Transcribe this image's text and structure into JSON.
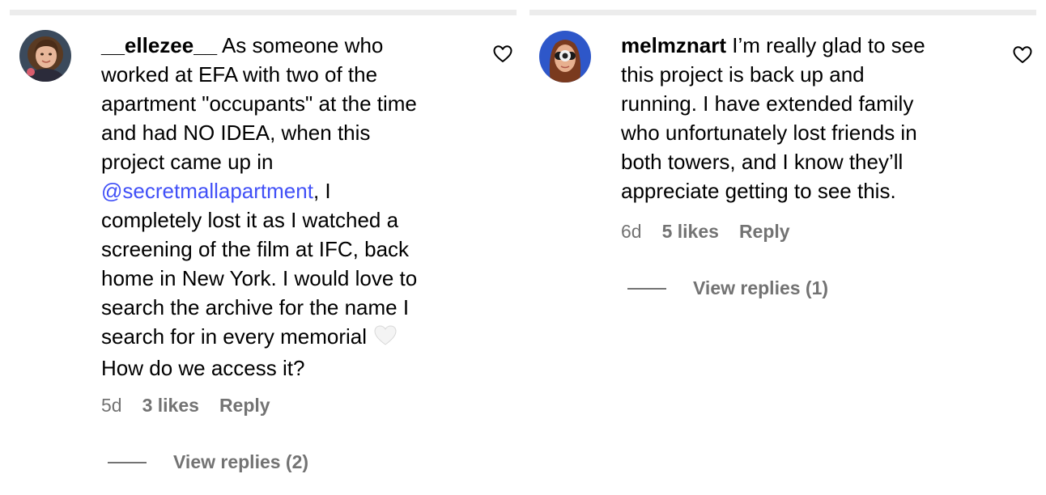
{
  "comments": [
    {
      "username": "__ellezee__",
      "text_before_mention": "As someone who\nworked at EFA with two of the\napartment \"occupants\" at the time\nand had NO IDEA, when this\nproject came up in\n",
      "mention": "@secretmallapartment",
      "text_after_mention": ", I\ncompletely lost it as I watched a\nscreening of the film at IFC, back\nhome in New York. I would love to\nsearch the archive for the name I\nsearch for in every memorial ",
      "emoji": "white-heart-emoji",
      "text_after_emoji": "\nHow do we access it?",
      "time": "5d",
      "likes": "3 likes",
      "reply_label": "Reply",
      "view_replies": "View replies (2)",
      "like_icon": "heart-outline-icon"
    },
    {
      "username": "melmznart",
      "text": "I’m really glad to see\nthis project is back up and\nrunning. I have extended family\nwho unfortunately lost friends in\nboth towers, and I know they’ll\nappreciate getting to see this.",
      "time": "6d",
      "likes": "5 likes",
      "reply_label": "Reply",
      "view_replies": "View replies (1)",
      "like_icon": "heart-outline-icon"
    }
  ],
  "colors": {
    "mention": "#4150f7",
    "meta_text": "#737373",
    "top_bar": "#ececec"
  }
}
